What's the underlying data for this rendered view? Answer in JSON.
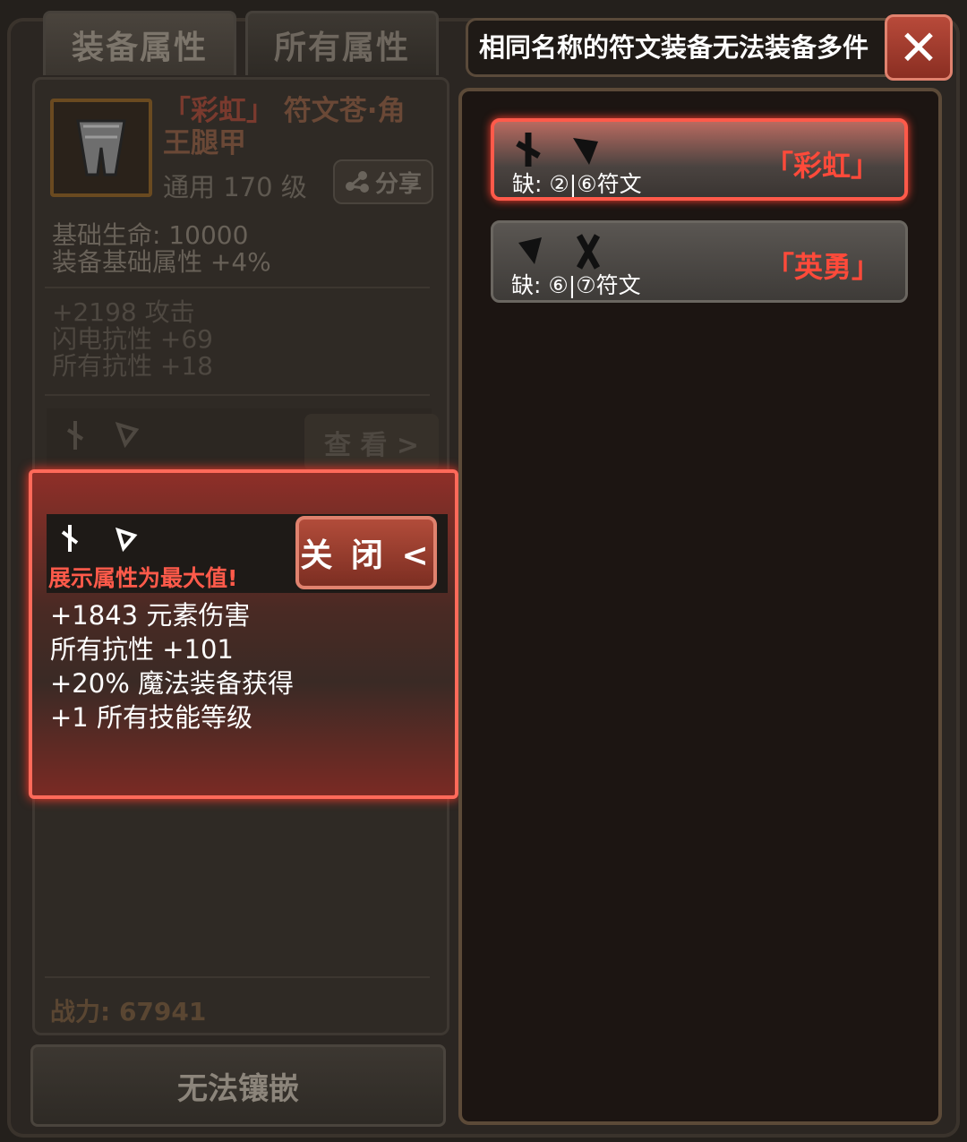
{
  "tabs": [
    {
      "label": "装备属性",
      "active": true
    },
    {
      "label": "所有属性",
      "active": false
    }
  ],
  "item": {
    "name_quote": "「彩虹」",
    "name_rest": "符文苍·角王腿甲",
    "sub": "通用 170 级",
    "share_label": "分享",
    "base_stats": [
      "基础生命:  10000",
      "装备基础属性 +4%"
    ],
    "extra_stats": [
      "+2198 攻击",
      "闪电抗性 +69",
      "所有抗性 +18"
    ],
    "view_label": "查 看 >"
  },
  "power": "战力: 67941",
  "inlay_button": "无法镶嵌",
  "popup": {
    "warning": "展示属性为最大值!",
    "close_label": "关 闭 <",
    "stats": [
      "+1843 元素伤害",
      "所有抗性 +101",
      "+20% 魔法装备获得",
      "+1 所有技能等级"
    ]
  },
  "right": {
    "title": "相同名称的符文装备无法装备多件",
    "close_icon": "close-icon",
    "cards": [
      {
        "name": "「彩虹」",
        "missing": "缺:  ②|⑥符文",
        "selected": true
      },
      {
        "name": "「英勇」",
        "missing": "缺:  ⑥|⑦符文",
        "selected": false
      }
    ]
  },
  "colors": {
    "accent_red": "#ff4a3a",
    "popup_border": "#ff6a5a",
    "panel_dark": "#1c1512"
  }
}
